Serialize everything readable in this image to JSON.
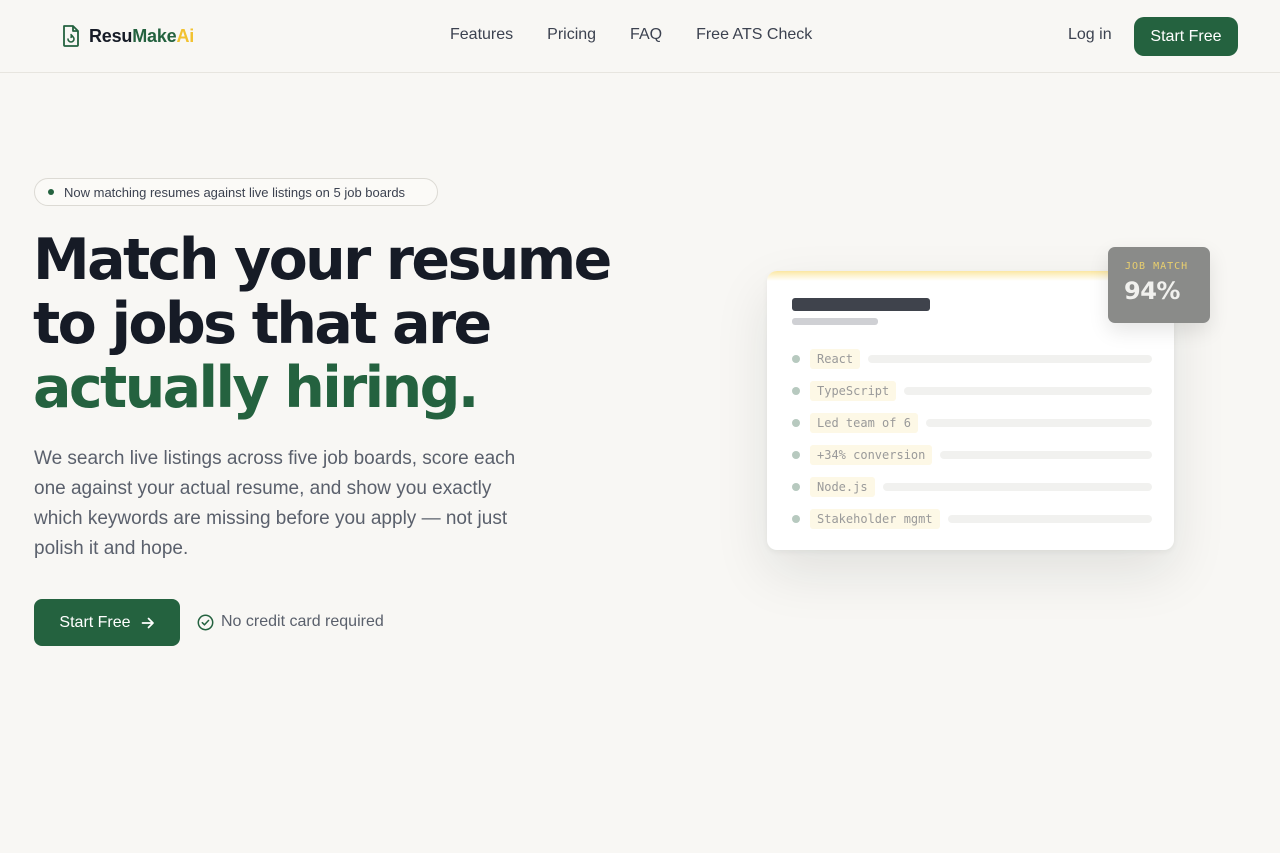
{
  "brand": {
    "name_part1": "Resu",
    "name_part2": "Make",
    "name_part3": "Ai",
    "colors": {
      "dark": "#161b26",
      "green": "#24623f",
      "yellow": "#f2c22f"
    }
  },
  "nav": {
    "links": [
      "Features",
      "Pricing",
      "FAQ",
      "Free ATS Check"
    ],
    "login": "Log in",
    "cta": "Start Free"
  },
  "hero": {
    "announcement": "Now matching resumes against live listings on 5 job boards",
    "headline_line1": "Match your resume",
    "headline_line2": "to jobs that are",
    "headline_line3": "actually hiring.",
    "subtext": "We search live listings across five job boards, score each one against your actual resume, and show you exactly which keywords are missing before you apply — not just polish it and hope.",
    "cta": "Start Free",
    "cta_icon": "arrow-right-icon",
    "note": "No credit card required",
    "note_icon": "check-circle-icon"
  },
  "preview": {
    "keywords": [
      "React",
      "TypeScript",
      "Led team of 6",
      "+34% conversion",
      "Node.js",
      "Stakeholder mgmt"
    ],
    "badge_label": "JOB MATCH",
    "badge_value": "94%"
  }
}
